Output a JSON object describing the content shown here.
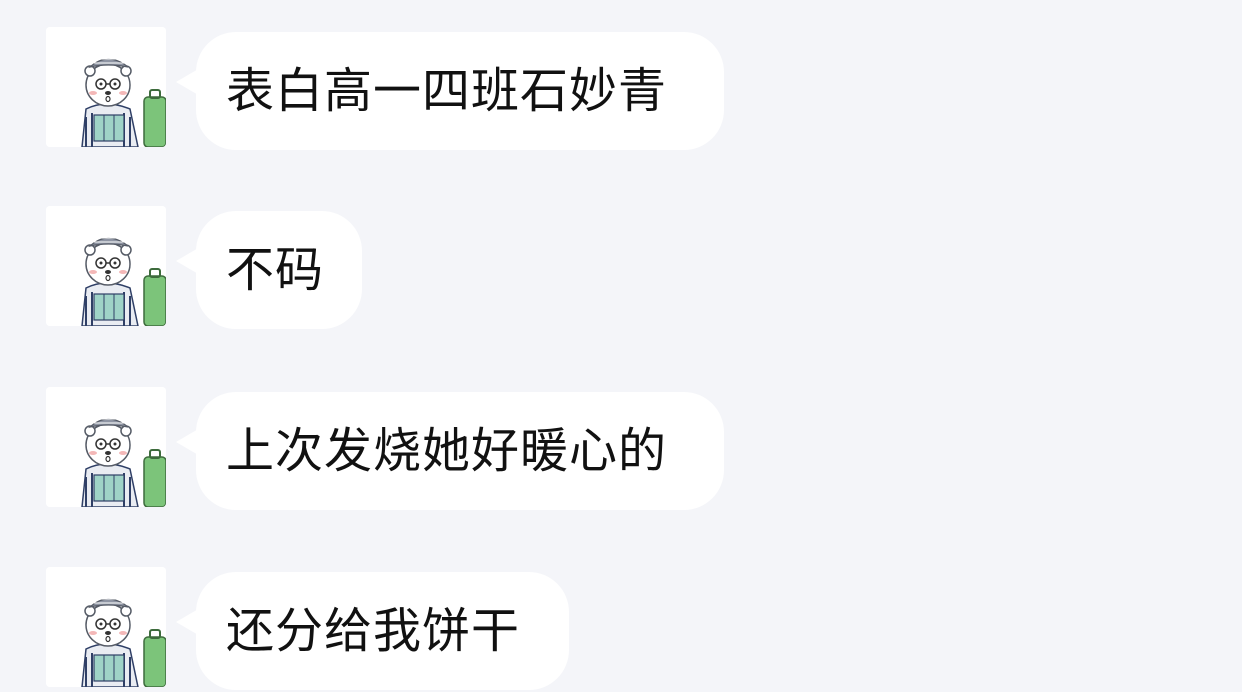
{
  "messages": [
    {
      "text": "表白高一四班石妙青",
      "avatar_icon": "polar-bear-avatar-icon"
    },
    {
      "text": "不码",
      "avatar_icon": "polar-bear-avatar-icon"
    },
    {
      "text": "上次发烧她好暖心的",
      "avatar_icon": "polar-bear-avatar-icon"
    },
    {
      "text": "还分给我饼干",
      "avatar_icon": "polar-bear-avatar-icon"
    }
  ],
  "colors": {
    "background": "#f4f5f9",
    "bubble": "#ffffff",
    "text": "#111111",
    "luggage": "#7cc47a",
    "jacket": "#2f3f66"
  }
}
